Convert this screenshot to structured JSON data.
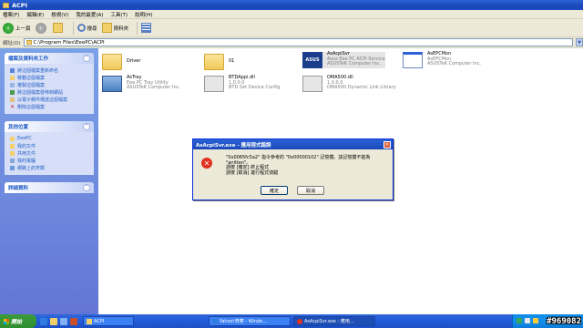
{
  "window": {
    "title": "ACPI"
  },
  "menu": [
    "檔案(F)",
    "編輯(E)",
    "檢視(V)",
    "我的最愛(A)",
    "工具(T)",
    "說明(H)"
  ],
  "toolbar": {
    "back": "上一頁",
    "search": "搜尋",
    "folders": "資料夾"
  },
  "address": {
    "label": "網址(D)",
    "path": "C:\\Program Files\\EeePC\\ACPI"
  },
  "tasks_panel": {
    "title": "檔案及資料夾工作",
    "items": [
      "將這個檔案重新命名",
      "移動這個檔案",
      "複製這個檔案",
      "將這個檔案發佈到網站",
      "以電子郵件傳送這個檔案",
      "刪除這個檔案"
    ]
  },
  "other_places": {
    "title": "其他位置",
    "items": [
      "EeePC",
      "我的文件",
      "共用文件",
      "我的電腦",
      "網路上的芳鄰"
    ]
  },
  "details": {
    "title": "詳細資料"
  },
  "files": [
    {
      "name": "Driver",
      "lines": []
    },
    {
      "name": "01",
      "lines": []
    },
    {
      "name": "AsAcpiSvr",
      "lines": [
        "Asus Eee PC ACPI Service",
        "ASUSTeK Computer Inc."
      ]
    },
    {
      "name": "AsEPCMon",
      "lines": [
        "AsEPCMon",
        "ASUSTeK Computer Inc."
      ]
    },
    {
      "name": "AsTray",
      "lines": [
        "Eee PC Tray Utility",
        "ASUSTeK Computer Inc."
      ]
    },
    {
      "name": "BTDAppi.dll",
      "lines": [
        "1.0.0.0",
        "BTD Set Device Config"
      ]
    },
    {
      "name": "OMA500.dll",
      "lines": [
        "1.0.0.0",
        "OMA500 Dynamic Link Library"
      ]
    }
  ],
  "dialog": {
    "title": "AsAcpiSvr.exe - 應用程式錯誤",
    "message": "\"0x0065fc5a2\" 指令參考的 \"0x00000102\" 記憶體。該記憶體不能為 \"written\"。",
    "hint1": "請按 [確定] 終止程式",
    "hint2": "請按 [取消] 進行程式偵錯",
    "ok": "確定",
    "cancel": "取消"
  },
  "taskbar": {
    "start": "開始",
    "buttons": [
      "ACPI",
      "Yahoo!奇摩 - Windo...",
      "AsAcpiSvr.exe - 應用..."
    ]
  },
  "watermark": "#969082"
}
